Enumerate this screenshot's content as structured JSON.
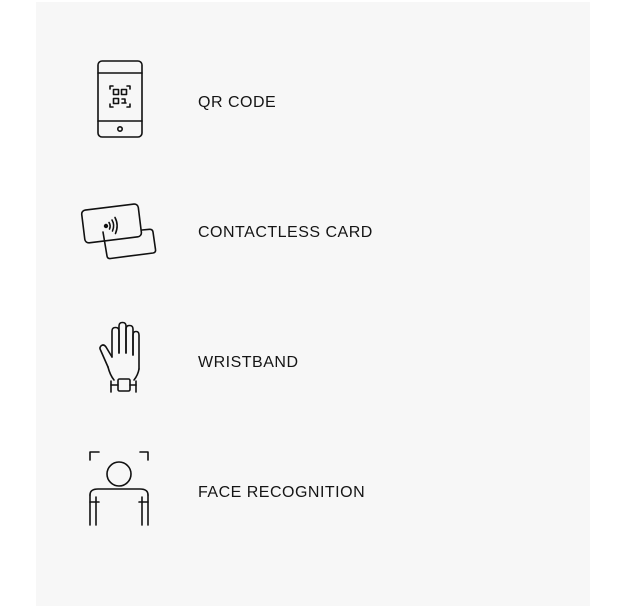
{
  "options": [
    {
      "icon": "qr-code-phone-icon",
      "label": "QR CODE"
    },
    {
      "icon": "contactless-card-icon",
      "label": "CONTACTLESS CARD"
    },
    {
      "icon": "wristband-hand-icon",
      "label": "WRISTBAND"
    },
    {
      "icon": "face-recognition-icon",
      "label": "FACE RECOGNITION"
    }
  ],
  "colors": {
    "background": "#ffffff",
    "panel": "#f7f7f7",
    "icon_stroke": "#111111",
    "text": "#151515"
  }
}
